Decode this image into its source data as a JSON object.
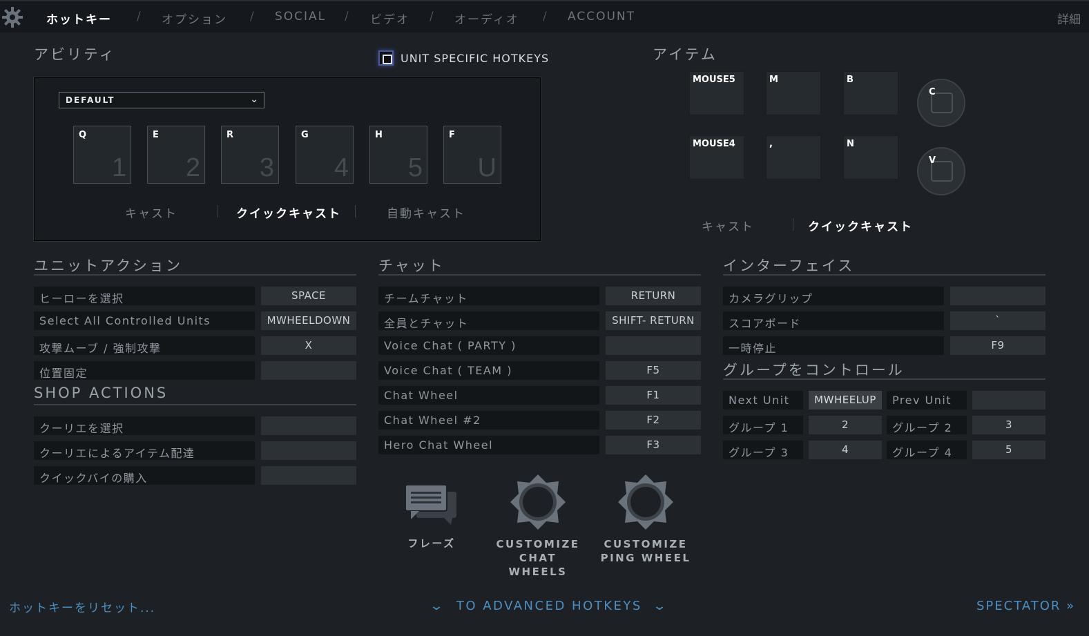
{
  "nav": {
    "tabs": [
      "ホットキー",
      "オプション",
      "SOCIAL",
      "ビデオ",
      "オーディオ",
      "ACCOUNT"
    ],
    "active_tab": "ホットキー",
    "separator": "/",
    "detail_link": "詳細"
  },
  "abilities": {
    "title": "アビリティ",
    "unit_specific_label": "UNIT SPECIFIC HOTKEYS",
    "unit_specific_checked": false,
    "preset": "DEFAULT",
    "slots": [
      {
        "key": "Q",
        "num": "1"
      },
      {
        "key": "E",
        "num": "2"
      },
      {
        "key": "R",
        "num": "3"
      },
      {
        "key": "G",
        "num": "4"
      },
      {
        "key": "H",
        "num": "5"
      },
      {
        "key": "F",
        "num": "U"
      }
    ],
    "cast_modes": [
      "キャスト",
      "クイックキャスト",
      "自動キャスト"
    ],
    "active_cast_mode": "クイックキャスト"
  },
  "items": {
    "title": "アイテム",
    "slots": [
      "MOUSE5",
      "M",
      "B",
      "MOUSE4",
      ",",
      "N"
    ],
    "round_slots": [
      "C",
      "V"
    ],
    "cast_modes": [
      "キャスト",
      "クイックキャスト"
    ],
    "active_cast_mode": "クイックキャスト"
  },
  "unit_actions": {
    "title": "ユニットアクション",
    "rows": [
      {
        "label": "ヒーローを選択",
        "key": "SPACE"
      },
      {
        "label": "Select All Controlled Units",
        "key": "MWHEELDOWN"
      },
      {
        "label": "攻撃ムーブ / 強制攻撃",
        "key": "X"
      },
      {
        "label": "位置固定",
        "key": ""
      }
    ]
  },
  "shop_actions": {
    "title": "SHOP ACTIONS",
    "rows": [
      {
        "label": "クーリエを選択",
        "key": ""
      },
      {
        "label": "クーリエによるアイテム配達",
        "key": ""
      },
      {
        "label": "クイックバイの購入",
        "key": ""
      }
    ]
  },
  "chat": {
    "title": "チャット",
    "rows": [
      {
        "label": "チームチャット",
        "key": "RETURN"
      },
      {
        "label": "全員とチャット",
        "key": "SHIFT- RETURN"
      },
      {
        "label": "Voice Chat ( PARTY )",
        "key": ""
      },
      {
        "label": "Voice Chat ( TEAM )",
        "key": "F5"
      },
      {
        "label": "Chat Wheel",
        "key": "F1"
      },
      {
        "label": "Chat Wheel #2",
        "key": "F2"
      },
      {
        "label": "Hero Chat Wheel",
        "key": "F3"
      }
    ]
  },
  "interface": {
    "title": "インターフェイス",
    "rows": [
      {
        "label": "カメラグリップ",
        "key": ""
      },
      {
        "label": "スコアボード",
        "key": "`"
      },
      {
        "label": "一時停止",
        "key": "F9"
      }
    ]
  },
  "groups": {
    "title": "グループをコントロール",
    "rows": [
      [
        {
          "label": "Next Unit",
          "key": "MWHEELUP"
        },
        {
          "label": "Prev Unit",
          "key": ""
        }
      ],
      [
        {
          "label": "グループ 1",
          "key": "2"
        },
        {
          "label": "グループ 2",
          "key": "3"
        }
      ],
      [
        {
          "label": "グループ 3",
          "key": "4"
        },
        {
          "label": "グループ 4",
          "key": "5"
        }
      ]
    ]
  },
  "shortcuts": {
    "phrases": "フレーズ",
    "chat_wheels_1": "CUSTOMIZE",
    "chat_wheels_2": "CHAT WHEELS",
    "ping_wheel_1": "CUSTOMIZE",
    "ping_wheel_2": "PING WHEEL"
  },
  "footer": {
    "reset": "ホットキーをリセット...",
    "advanced": "TO ADVANCED HOTKEYS",
    "spectator": "SPECTATOR"
  },
  "colors": {
    "background": "#1d2126",
    "link": "#4c8fc2",
    "active_text": "#ffffff"
  }
}
